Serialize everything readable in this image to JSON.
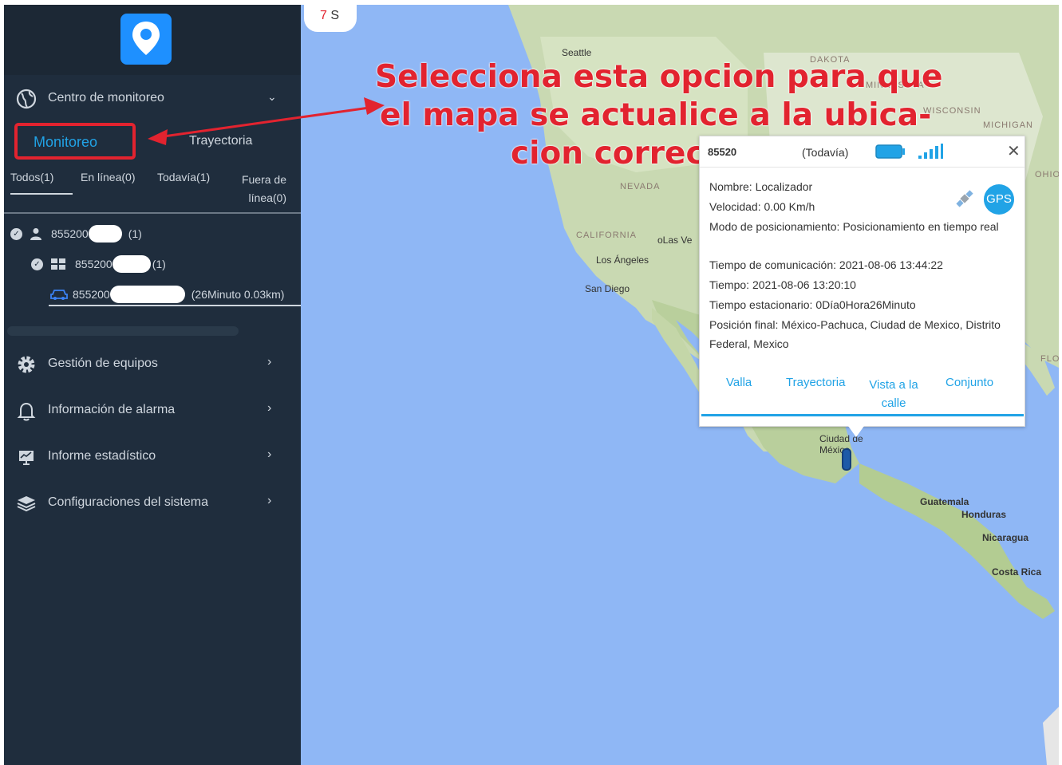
{
  "sidebar": {
    "menu_title": "Centro de monitoreo",
    "tab_active": "Monitoreo",
    "tab_other": "Trayectoria",
    "filters": [
      "Todos(1)",
      "En línea(0)",
      "Todavía(1)",
      "Fuera de línea(0)"
    ],
    "tree": [
      {
        "label": "855200",
        "count": "(1)"
      },
      {
        "label": "855200",
        "count": "(1)"
      },
      {
        "label": "855200",
        "detail": "(26Minuto  0.03km)"
      }
    ],
    "nav": [
      {
        "label": "Gestión de equipos",
        "icon": "gear-icon"
      },
      {
        "label": "Información de alarma",
        "icon": "bell-icon"
      },
      {
        "label": "Informe estadístico",
        "icon": "chart-icon"
      },
      {
        "label": "Configuraciones del sistema",
        "icon": "layers-icon"
      }
    ]
  },
  "map": {
    "timer_number": "7",
    "timer_unit": "S",
    "labels": {
      "seattle": "Seattle",
      "dakota": "DAKOTA",
      "minnesota": "MINNESOTA",
      "wisconsin": "WISCONSIN",
      "michigan": "MICHIGAN",
      "nevada": "NEVADA",
      "california": "CALIFORNIA",
      "lasvegas": "oLas Ve",
      "losangeles": "Los Ángeles",
      "sandiego": "San Diego",
      "guatemala": "Guatemala",
      "honduras": "Honduras",
      "nicaragua": "Nicaragua",
      "costarica": "Costa Rica",
      "ciudad": "Ciudad de México",
      "ohio": "OHIO",
      "flor": "FLOR"
    }
  },
  "annotation": {
    "line1": "Selecciona esta opcion para que",
    "line2": "el mapa se actualice a la ubica-",
    "line3": "cion correcta."
  },
  "popup": {
    "device_id": "85520",
    "status": "(Todavía)",
    "gps_badge": "GPS",
    "fields": [
      {
        "label": "Nombre:",
        "value": "Localizador"
      },
      {
        "label": "Velocidad:",
        "value": "0.00 Km/h"
      },
      {
        "label": "Modo de posicionamiento:",
        "value": "Posicionamiento en tiempo real"
      },
      {
        "label": "Tiempo de comunicación:",
        "value": "2021-08-06 13:44:22"
      },
      {
        "label": "Tiempo:",
        "value": "2021-08-06 13:20:10"
      },
      {
        "label": "Tiempo estacionario:",
        "value": "0Día0Hora26Minuto"
      },
      {
        "label": "Posición final:",
        "value": "México-Pachuca, Ciudad de Mexico, Distrito Federal, Mexico"
      }
    ],
    "actions": [
      "Valla",
      "Trayectoria",
      "Vista a la calle",
      "Conjunto"
    ]
  },
  "colors": {
    "sidebar_bg": "#1f2d3d",
    "accent": "#21a3e6",
    "annotation": "#e2232f",
    "water": "#8fb7f5"
  }
}
